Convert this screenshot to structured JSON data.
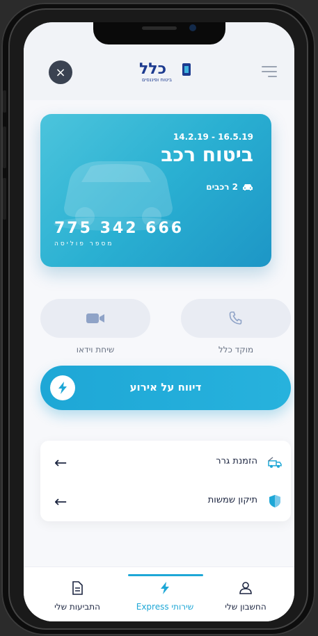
{
  "header": {
    "close_label": "×",
    "logo_text": "כלל",
    "logo_subtext": "ביטוח ופיננסים"
  },
  "policy_card": {
    "dates": "14.2.19 - 16.5.19",
    "title": "ביטוח רכב",
    "cars": "2 רכבים",
    "policy_number": "775 342 666",
    "policy_number_label": "מספר פוליסה"
  },
  "contacts": {
    "video_label": "שיחת וידאו",
    "call_center_label": "מוקד כלל"
  },
  "report": {
    "label": "דיווח על אירוע"
  },
  "services": [
    {
      "label": "הזמנת גרר",
      "arrow": "←",
      "icon": "tow-truck-icon"
    },
    {
      "label": "תיקון שמשות",
      "arrow": "←",
      "icon": "shield-icon"
    }
  ],
  "tabs": [
    {
      "label": "התביעות שלי",
      "icon": "document-icon"
    },
    {
      "label": "שירותי Express",
      "icon": "lightning-icon",
      "active": true
    },
    {
      "label": "החשבון שלי",
      "icon": "user-icon"
    }
  ],
  "colors": {
    "accent": "#1ea7d6",
    "card_gradient_start": "#4cc4dc",
    "card_gradient_end": "#1d96c6",
    "dark": "#3a4251"
  }
}
